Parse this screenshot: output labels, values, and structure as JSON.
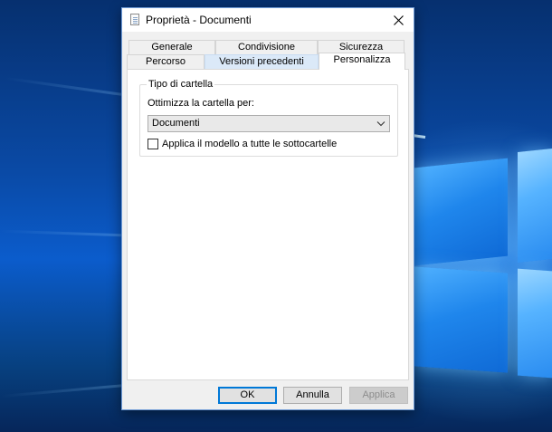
{
  "dialog": {
    "title": "Proprietà - Documenti",
    "tabs_row1": [
      "Generale",
      "Condivisione",
      "Sicurezza"
    ],
    "tabs_row2": [
      "Percorso",
      "Versioni precedenti",
      "Personalizza"
    ],
    "active_tab": "Personalizza"
  },
  "folder_type": {
    "group_title": "Tipo di cartella",
    "optimize_label": "Ottimizza la cartella per:",
    "selected": "Documenti",
    "apply_checkbox_label": "Applica il modello a tutte le sottocartelle",
    "apply_checked": false
  },
  "buttons": {
    "ok": "OK",
    "cancel": "Annulla",
    "apply": "Applica"
  },
  "colors": {
    "accent": "#0078d7",
    "hover_tab": "#dbe9f8",
    "dialog_bg": "#f0f0f0"
  },
  "icons": {
    "title": "document-properties-icon",
    "close": "close-icon",
    "dropdown": "chevron-down-icon"
  }
}
